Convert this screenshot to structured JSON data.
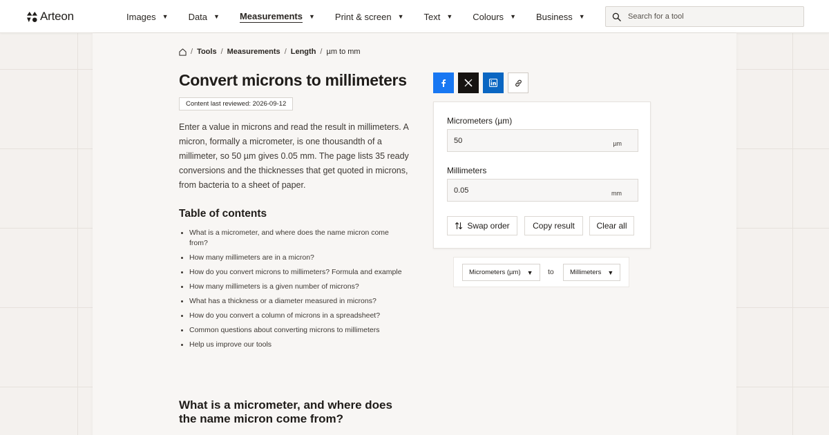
{
  "header": {
    "logo_text": "Arteon",
    "nav": [
      {
        "label": "Images"
      },
      {
        "label": "Data"
      },
      {
        "label": "Measurements",
        "active": true
      },
      {
        "label": "Print & screen"
      },
      {
        "label": "Text"
      },
      {
        "label": "Colours"
      },
      {
        "label": "Business"
      }
    ],
    "search_placeholder": "Search for a tool"
  },
  "breadcrumb": [
    "Tools",
    "Measurements",
    "Length",
    "µm to mm"
  ],
  "page": {
    "title": "Convert microns to millimeters",
    "reviewed": "Content last reviewed: 2026-09-12",
    "intro": "Enter a value in microns and read the result in millimeters. A micron, formally a micrometer, is one thousandth of a millimeter, so 50 µm gives 0.05 mm. The page lists 35 ready conversions and the thicknesses that get quoted in microns, from bacteria to a sheet of paper.",
    "toc_title": "Table of contents",
    "toc": [
      "What is a micrometer, and where does the name micron come from?",
      "How many millimeters are in a micron?",
      "How do you convert microns to millimeters? Formula and example",
      "How many millimeters is a given number of microns?",
      "What has a thickness or a diameter measured in microns?",
      "How do you convert a column of microns in a spreadsheet?",
      "Common questions about converting microns to millimeters",
      "Help us improve our tools"
    ],
    "section_title": "What is a micrometer, and where does the name micron come from?"
  },
  "share": {
    "icons": [
      "facebook-icon",
      "x-icon",
      "linkedin-icon",
      "link-icon"
    ]
  },
  "converter": {
    "from_label": "Micrometers (µm)",
    "from_value": "50",
    "from_unit": "µm",
    "to_label": "Millimeters",
    "to_value": "0.05",
    "to_unit": "mm",
    "swap_label": "Swap order",
    "copy_label": "Copy result",
    "clear_label": "Clear all"
  },
  "unit_select": {
    "from": "Micrometers (µm)",
    "to_word": "to",
    "to": "Millimeters"
  },
  "colors": {
    "facebook": "#1877f2",
    "x": "#161311",
    "linkedin": "#0a66c2",
    "page_bg": "#f4f1ee",
    "sheet_bg": "#f8f6f4"
  }
}
